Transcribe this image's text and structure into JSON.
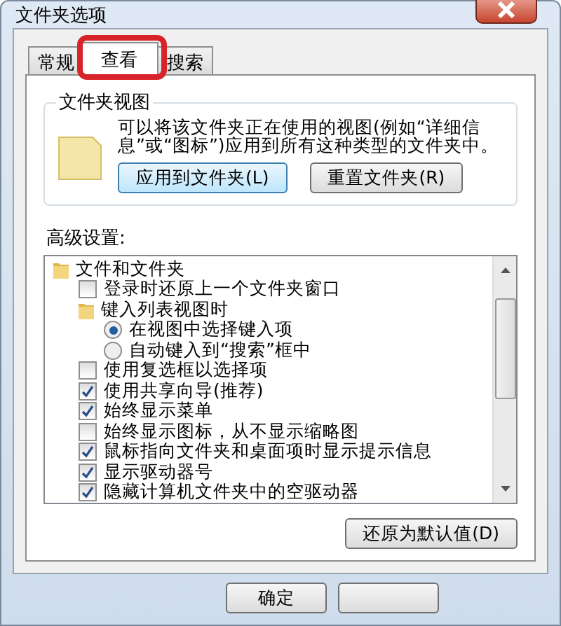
{
  "window": {
    "title": "文件夹选项"
  },
  "tabs": [
    {
      "label": "常规",
      "selected": false
    },
    {
      "label": "查看",
      "selected": true
    },
    {
      "label": "搜索",
      "selected": false
    }
  ],
  "folder_views": {
    "title": "文件夹视图",
    "description": "可以将该文件夹正在使用的视图(例如“详细信息”或“图标”)应用到所有这种类型的文件夹中。",
    "buttons": [
      "应用到文件夹(L)",
      "重置文件夹(R)"
    ]
  },
  "advanced": {
    "label": "高级设置:",
    "items": [
      {
        "kind": "folder",
        "label": "文件和文件夹",
        "children": [
          {
            "kind": "checkbox",
            "label": "登录时还原上一个文件夹窗口",
            "checked": false
          },
          {
            "kind": "folder",
            "label": "键入列表视图时",
            "children": [
              {
                "kind": "radio",
                "label": "在视图中选择键入项",
                "selected": true
              },
              {
                "kind": "radio",
                "label": "自动键入到“搜索”框中",
                "selected": false
              }
            ]
          },
          {
            "kind": "checkbox",
            "label": "使用复选框以选择项",
            "checked": false
          },
          {
            "kind": "checkbox",
            "label": "使用共享向导(推荐)",
            "checked": true
          },
          {
            "kind": "checkbox",
            "label": "始终显示菜单",
            "checked": true
          },
          {
            "kind": "checkbox",
            "label": "始终显示图标，从不显示缩略图",
            "checked": false
          },
          {
            "kind": "checkbox",
            "label": "鼠标指向文件夹和桌面项时显示提示信息",
            "checked": true
          },
          {
            "kind": "checkbox",
            "label": "显示驱动器号",
            "checked": true
          },
          {
            "kind": "checkbox",
            "label": "隐藏计算机文件夹中的空驱动器",
            "checked": true
          }
        ]
      }
    ],
    "restore_button": "还原为默认值(D)"
  },
  "footer_buttons": [
    "确定"
  ]
}
